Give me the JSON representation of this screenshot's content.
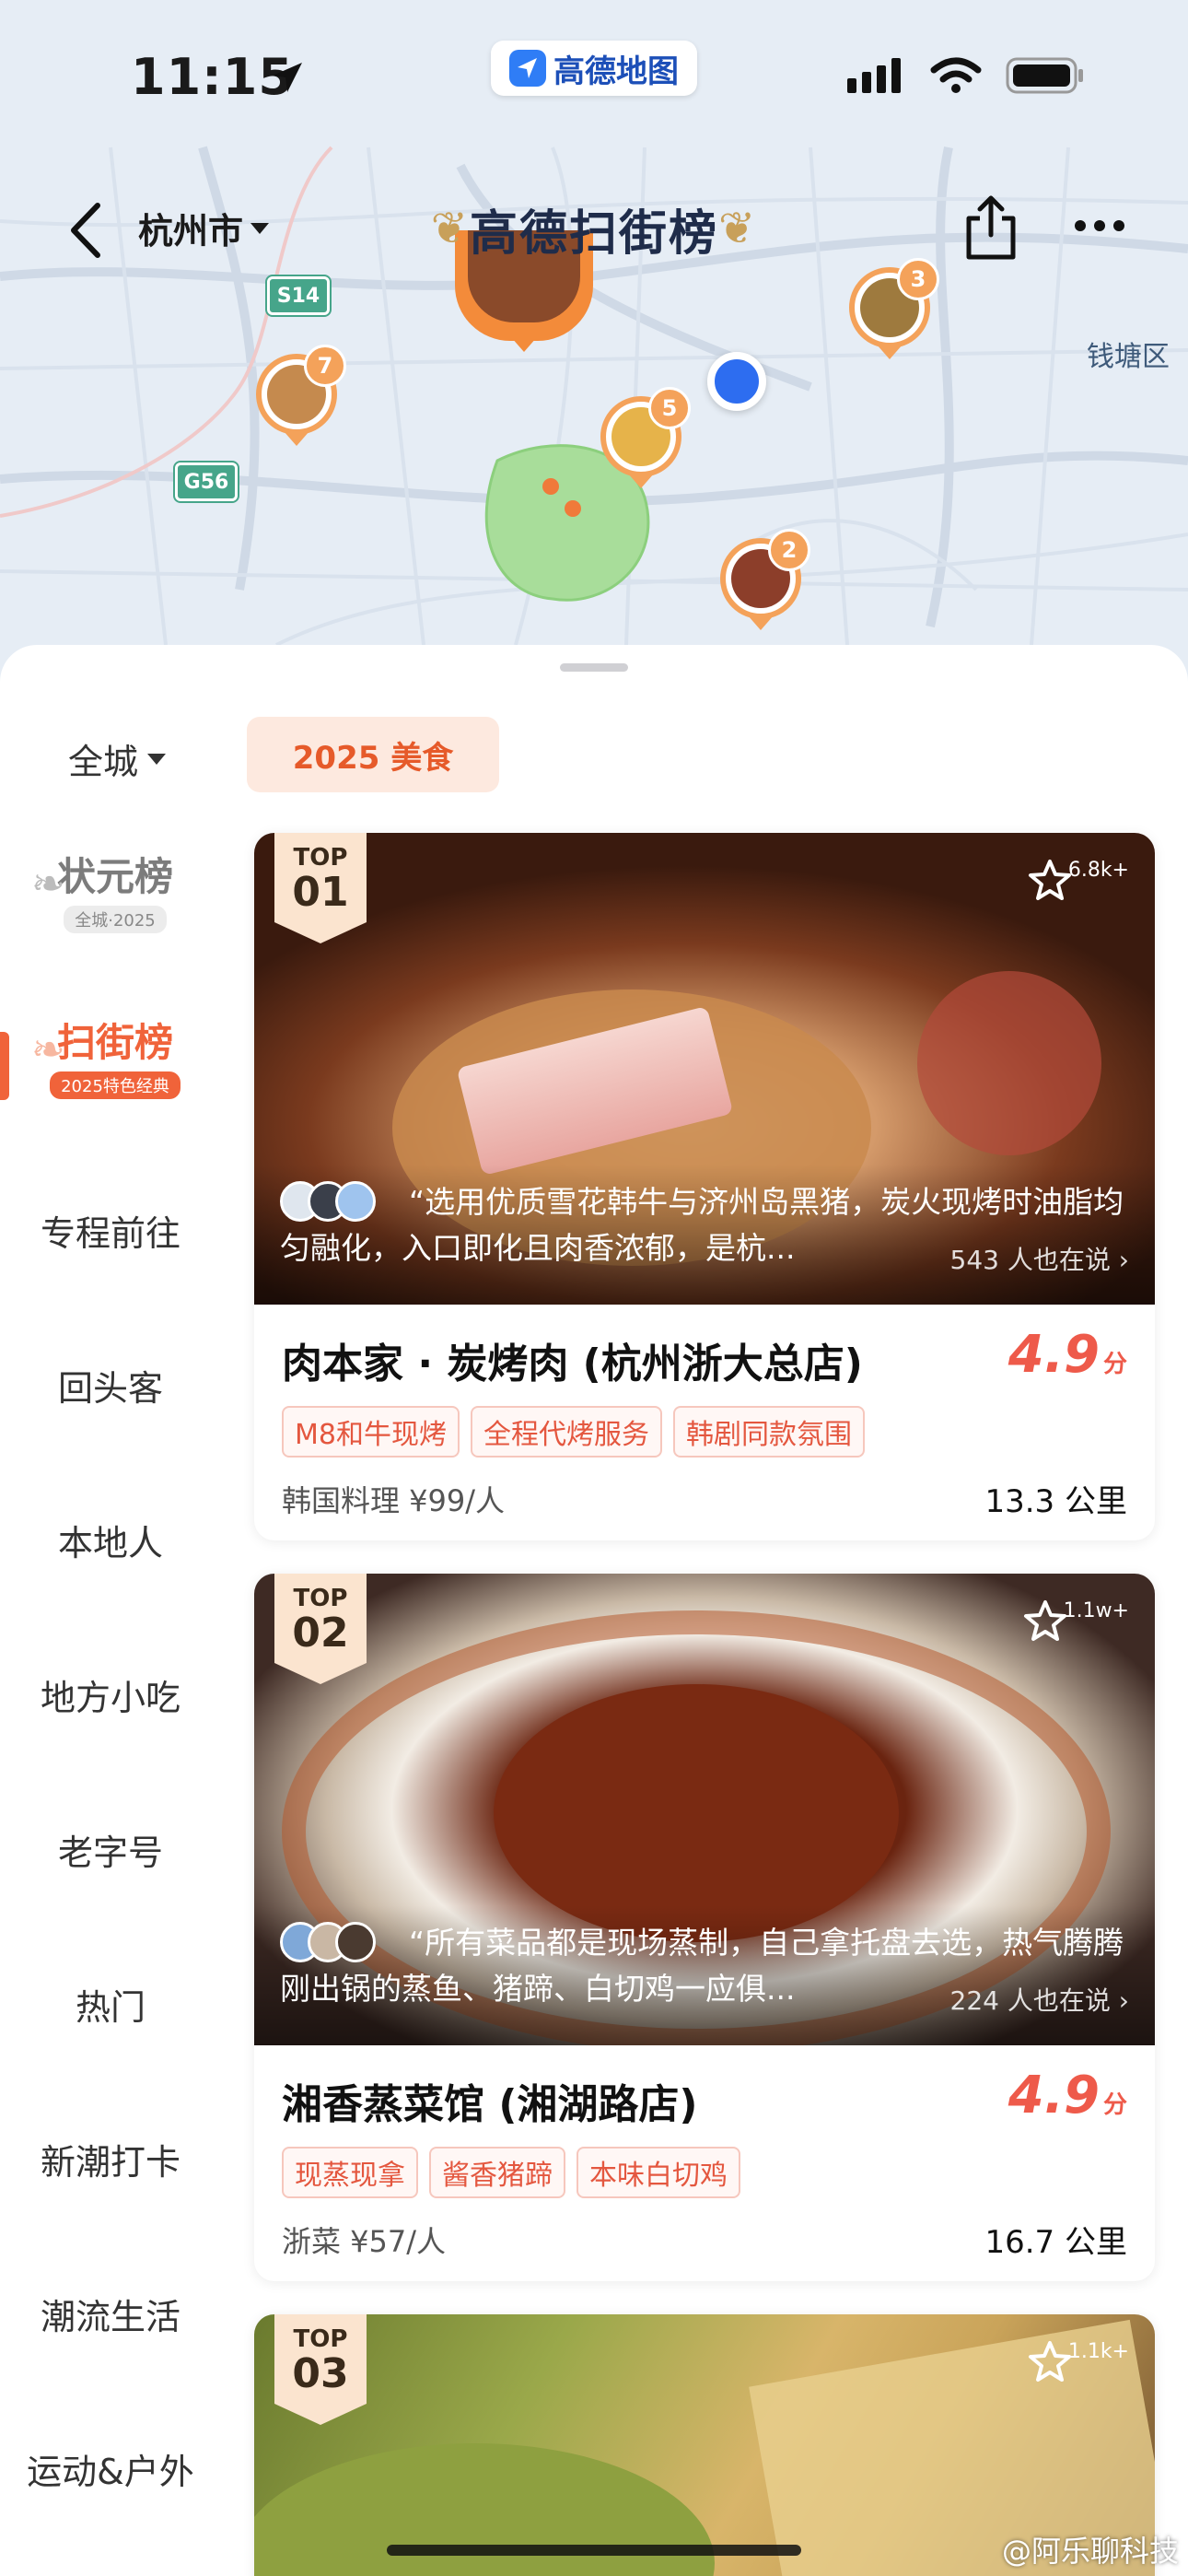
{
  "status_bar": {
    "time": "11:15",
    "app_name": "高德地图"
  },
  "nav": {
    "city": "杭州市",
    "title": "高德扫街榜"
  },
  "map": {
    "labels": {
      "district": "钱塘区",
      "road_s14": "S14",
      "road_g56": "G56"
    },
    "pins": [
      {
        "num": "7",
        "food_color": "#c58a4e"
      },
      {
        "num": "5",
        "food_color": "#e6b34a"
      },
      {
        "num": "3",
        "food_color": "#9e7a3e"
      },
      {
        "num": "2",
        "food_color": "#8c3e2a"
      }
    ]
  },
  "panel": {
    "scope": "全城",
    "year_tab": "2025 美食"
  },
  "sidebar": {
    "badge_champion": {
      "title": "状元榜",
      "sub": "全城·2025"
    },
    "badge_street": {
      "title": "扫街榜",
      "sub": "2025特色经典"
    },
    "items": [
      {
        "label": "专程前往"
      },
      {
        "label": "回头客"
      },
      {
        "label": "本地人"
      },
      {
        "label": "地方小吃"
      },
      {
        "label": "老字号"
      },
      {
        "label": "热门"
      },
      {
        "label": "新潮打卡"
      },
      {
        "label": "潮流生活"
      },
      {
        "label": "运动&户外"
      }
    ]
  },
  "cards": [
    {
      "rank_top": "TOP",
      "rank_num": "01",
      "fav_count": "6.8k+",
      "quote": "“选用优质雪花韩牛与济州岛黑猪，炭火现烤时油脂均匀融化，入口即化且肉香浓郁，是杭...",
      "quote_meta": "543 人也在说 ›",
      "name": "肉本家 · 炭烤肉 (杭州浙大总店)",
      "score": "4.9",
      "score_unit": "分",
      "tags": [
        "M8和牛现烤",
        "全程代烤服务",
        "韩剧同款氛围"
      ],
      "category_price": "韩国料理  ¥99/人",
      "distance": "13.3 公里"
    },
    {
      "rank_top": "TOP",
      "rank_num": "02",
      "fav_count": "1.1w+",
      "quote": "“所有菜品都是现场蒸制，自己拿托盘去选，热气腾腾刚出锅的蒸鱼、猪蹄、白切鸡一应俱...",
      "quote_meta": "224 人也在说 ›",
      "name": "湘香蒸菜馆 (湘湖路店)",
      "score": "4.9",
      "score_unit": "分",
      "tags": [
        "现蒸现拿",
        "酱香猪蹄",
        "本味白切鸡"
      ],
      "category_price": "浙菜  ¥57/人",
      "distance": "16.7 公里"
    },
    {
      "rank_top": "TOP",
      "rank_num": "03",
      "fav_count": "1.1k+"
    }
  ],
  "watermark": "@阿乐聊科技"
}
